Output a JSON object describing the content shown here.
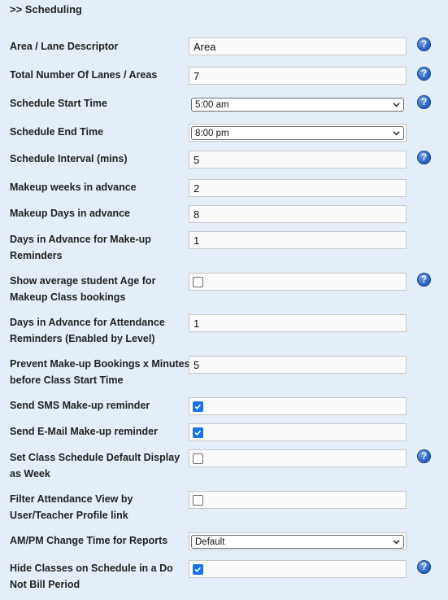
{
  "section": {
    "title": ">> Scheduling"
  },
  "fields": {
    "area_descriptor": {
      "label": "Area / Lane Descriptor",
      "value": "Area"
    },
    "total_lanes": {
      "label": "Total Number Of Lanes / Areas",
      "value": "7"
    },
    "schedule_start": {
      "label": "Schedule Start Time",
      "value": "5:00 am"
    },
    "schedule_end": {
      "label": "Schedule End Time",
      "value": "8:00 pm"
    },
    "schedule_interval": {
      "label": "Schedule Interval (mins)",
      "value": "5"
    },
    "makeup_weeks": {
      "label": "Makeup weeks in advance",
      "value": "2"
    },
    "makeup_days": {
      "label": "Makeup Days in advance",
      "value": "8"
    },
    "makeup_reminder_days": {
      "label": "Days in Advance for Make-up Reminders",
      "value": "1"
    },
    "show_avg_age": {
      "label": "Show average student Age for Makeup Class bookings",
      "checked": false
    },
    "attendance_reminder_days": {
      "label": "Days in Advance for Attendance Reminders (Enabled by Level)",
      "value": "1"
    },
    "prevent_makeup_minutes": {
      "label": "Prevent Make-up Bookings x Minutes before Class Start Time",
      "value": "5"
    },
    "send_sms_reminder": {
      "label": "Send SMS Make-up reminder",
      "checked": true
    },
    "send_email_reminder": {
      "label": "Send E-Mail Make-up reminder",
      "checked": true
    },
    "default_display_week": {
      "label": "Set Class Schedule Default Display as Week",
      "checked": false
    },
    "filter_attendance_view": {
      "label": "Filter Attendance View by User/Teacher Profile link",
      "checked": false
    },
    "ampm_change_time": {
      "label": "AM/PM Change Time for Reports",
      "value": "Default"
    },
    "hide_do_not_bill": {
      "label": "Hide Classes on Schedule in a Do Not Bill Period",
      "checked": true
    }
  },
  "help_icon": {
    "glyph": "?"
  },
  "colors": {
    "background": "#e3eef8",
    "checkbox_checked": "#1a73e8",
    "help_icon": "#2e66c4"
  }
}
